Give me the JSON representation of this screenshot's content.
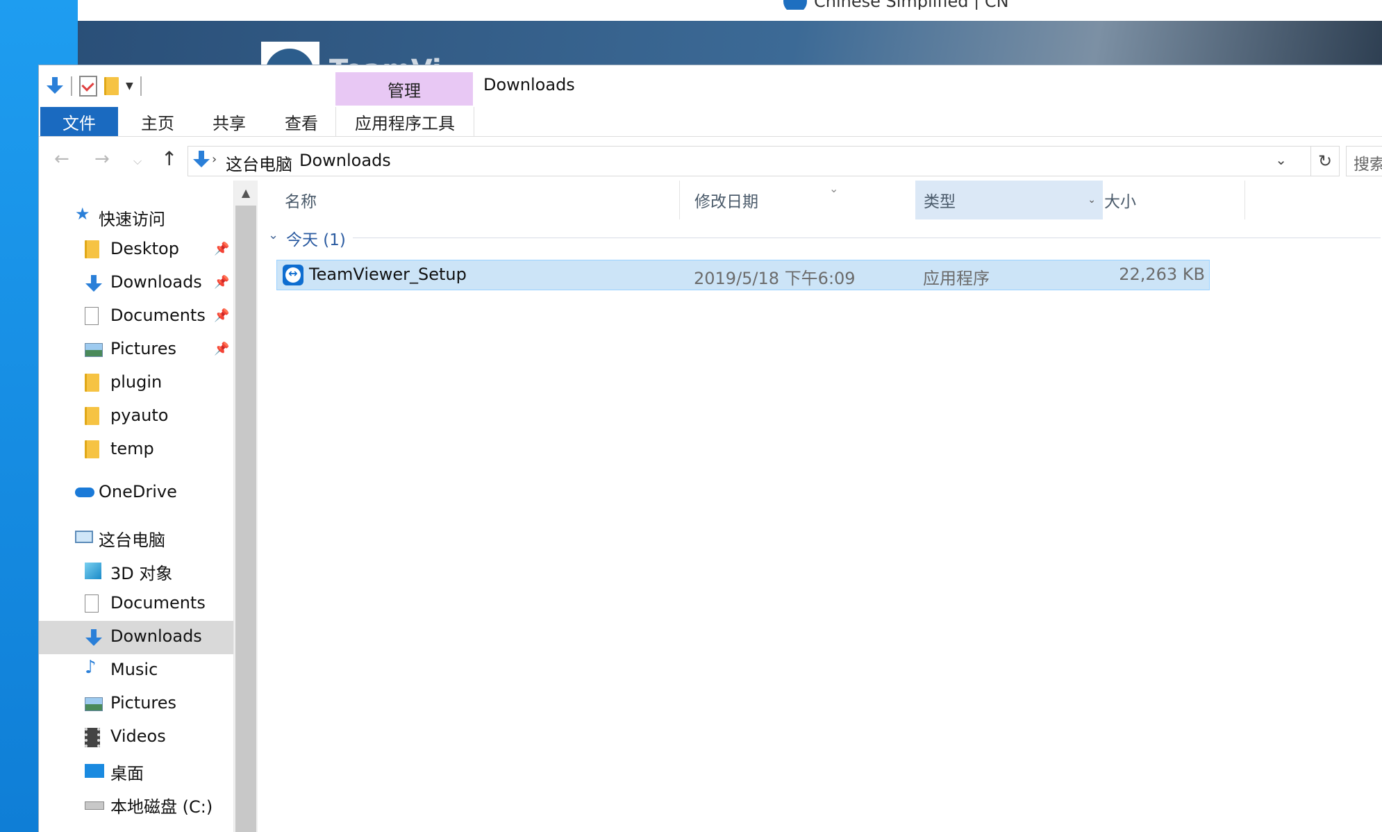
{
  "background": {
    "language_label": "Chinese Simplified | CN",
    "app_name_partial": "TeamVi"
  },
  "explorer": {
    "title": "Downloads",
    "contextual_tab_group": "管理",
    "ribbon_tabs": [
      "文件",
      "主页",
      "共享",
      "查看",
      "应用程序工具"
    ],
    "breadcrumb": [
      "这台电脑",
      "Downloads"
    ],
    "search_placeholder": "搜索\"Downloads\"",
    "nav": {
      "quick_access": "快速访问",
      "quick_items": [
        "Desktop",
        "Downloads",
        "Documents",
        "Pictures",
        "plugin",
        "pyauto",
        "temp"
      ],
      "onedrive": "OneDrive",
      "this_pc": "这台电脑",
      "pc_items": [
        "3D 对象",
        "Documents",
        "Downloads",
        "Music",
        "Pictures",
        "Videos",
        "桌面",
        "本地磁盘 (C:)"
      ],
      "selected": "Downloads"
    },
    "columns": {
      "name": "名称",
      "date": "修改日期",
      "type": "类型",
      "size": "大小"
    },
    "group": {
      "label": "今天 (1)"
    },
    "files": [
      {
        "name": "TeamViewer_Setup",
        "date": "2019/5/18 下午6:09",
        "type": "应用程序",
        "size": "22,263 KB"
      }
    ]
  },
  "colors": {
    "accent": "#1a6ac0",
    "selection": "#cce4f7",
    "selection_border": "#99d1ff",
    "contextual_tab": "#e8c8f4",
    "desktop": "#1b8fe0"
  },
  "icons": {
    "qat": [
      "down-arrow-icon",
      "properties-icon",
      "new-folder-icon",
      "dropdown-icon"
    ],
    "nav": [
      "star-icon",
      "folder-icon",
      "download-icon",
      "document-icon",
      "picture-icon",
      "cloud-icon",
      "computer-icon",
      "cube-icon",
      "music-icon",
      "video-icon",
      "desktop-icon",
      "drive-icon",
      "pin-icon"
    ]
  }
}
